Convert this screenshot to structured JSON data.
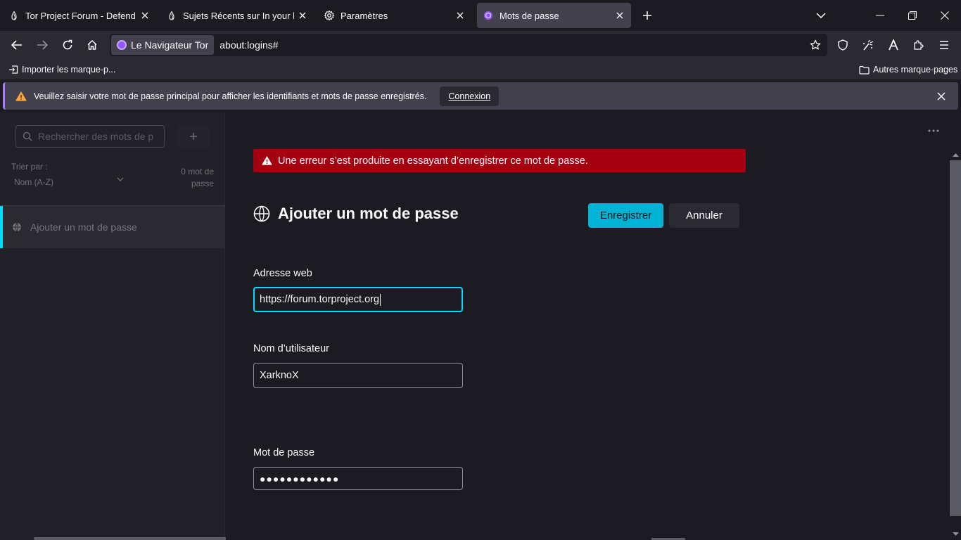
{
  "tabs": [
    {
      "title": "Tor Project Forum - Defend you",
      "icon": "onion-icon",
      "active": false
    },
    {
      "title": "Sujets Récents sur In your langu",
      "icon": "onion-icon",
      "active": false
    },
    {
      "title": "Paramètres",
      "icon": "gear-icon",
      "active": false
    },
    {
      "title": "Mots de passe",
      "icon": "tor-browser-icon",
      "active": true
    }
  ],
  "navbar": {
    "identity_label": "Le Navigateur Tor",
    "url": "about:logins#"
  },
  "bookmarks": {
    "import_label": "Importer les marque-p...",
    "other_label": "Autres marque-pages"
  },
  "notification": {
    "message": "Veuillez saisir votre mot de passe principal pour afficher les identifiants et mots de passe enregistrés.",
    "button": "Connexion"
  },
  "sidebar": {
    "search_placeholder": "Rechercher des mots de p",
    "sort_label": "Trier par :",
    "sort_value": "Nom (A-Z)",
    "count_line1": "0 mot de",
    "count_line2": "passe",
    "item_label": "Ajouter un mot de passe"
  },
  "main": {
    "error": "Une erreur s’est produite en essayant d’enregistrer ce mot de passe.",
    "title": "Ajouter un mot de passe",
    "save_label": "Enregistrer",
    "cancel_label": "Annuler",
    "web_label": "Adresse web",
    "web_value": "https://forum.torproject.org",
    "user_label": "Nom d’utilisateur",
    "user_value": "XarknoX",
    "pass_label": "Mot de passe",
    "pass_value": "●●●●●●●●●●●●"
  },
  "colors": {
    "accent": "#00b3d4",
    "focus": "#00ddff",
    "error": "#a4000f",
    "tor_purple": "#9059ff"
  }
}
